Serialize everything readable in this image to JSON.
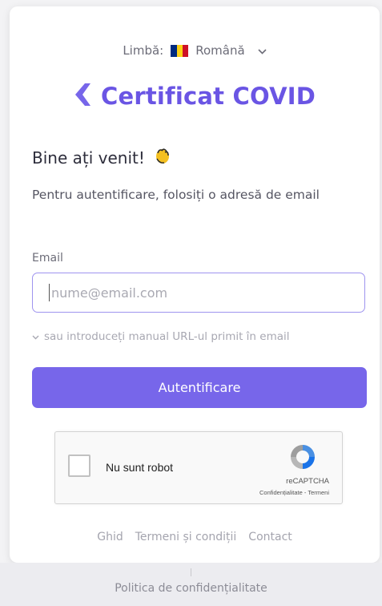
{
  "language": {
    "label": "Limbă:",
    "value": "Română"
  },
  "brand": {
    "title": "Certificat COVID"
  },
  "welcome": {
    "title": "Bine ați venit!"
  },
  "description": "Pentru autentificare, folosiți o adresă de email",
  "email": {
    "label": "Email",
    "placeholder": "nume@email.com"
  },
  "manual_url": "sau introduceți manual URL-ul primit în email",
  "login_button": "Autentificare",
  "captcha": {
    "label": "Nu sunt robot",
    "brand": "reCAPTCHA",
    "links": "Confidențialitate - Termeni"
  },
  "footer": {
    "guide": "Ghid",
    "terms": "Termeni și condiții",
    "contact": "Contact"
  },
  "bottom": {
    "privacy": "Politica de confidențialitate"
  },
  "colors": {
    "accent": "#7766ea",
    "brand": "#6a55e4",
    "flag_blue": "#002b7f",
    "flag_yellow": "#fcd116",
    "flag_red": "#ce1126"
  },
  "icons": [
    "romania-flag-icon",
    "chevron-down-icon",
    "brand-logo-icon",
    "waving-hand-icon",
    "recaptcha-icon"
  ]
}
